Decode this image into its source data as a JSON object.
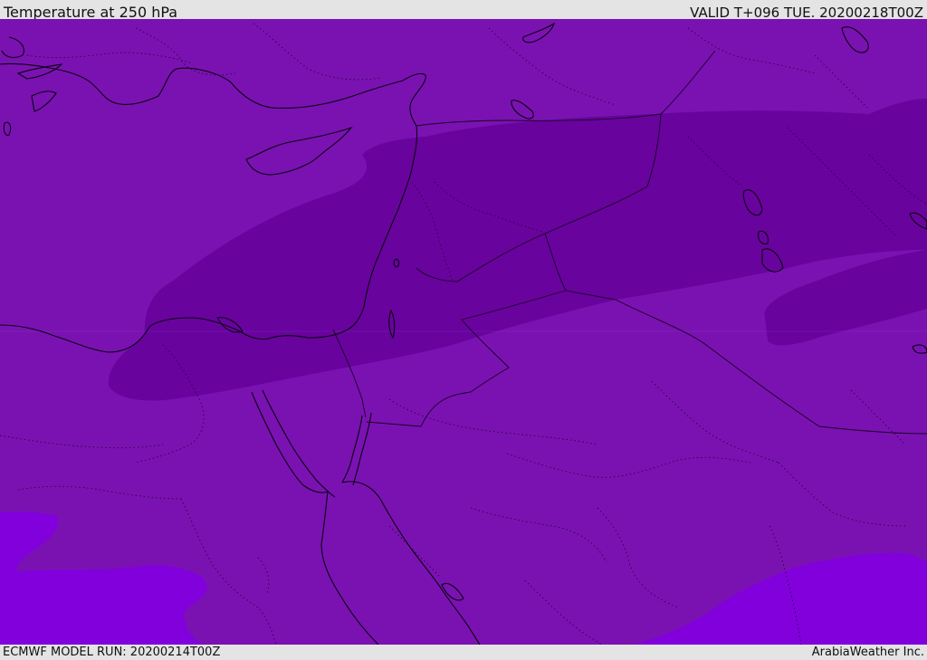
{
  "header": {
    "title": "Temperature at 250 hPa",
    "valid": "VALID T+096 TUE. 20200218T00Z"
  },
  "footer": {
    "model_run": "ECMWF MODEL RUN: 20200214T00Z",
    "credit": "ArabiaWeather Inc."
  },
  "map": {
    "colors": {
      "medium": "#7a12b2",
      "dark": "#68039d",
      "bright": "#8200dc",
      "coastline": "#0b0010",
      "borders": "#1a0022",
      "background": "#e4e4e4"
    }
  }
}
